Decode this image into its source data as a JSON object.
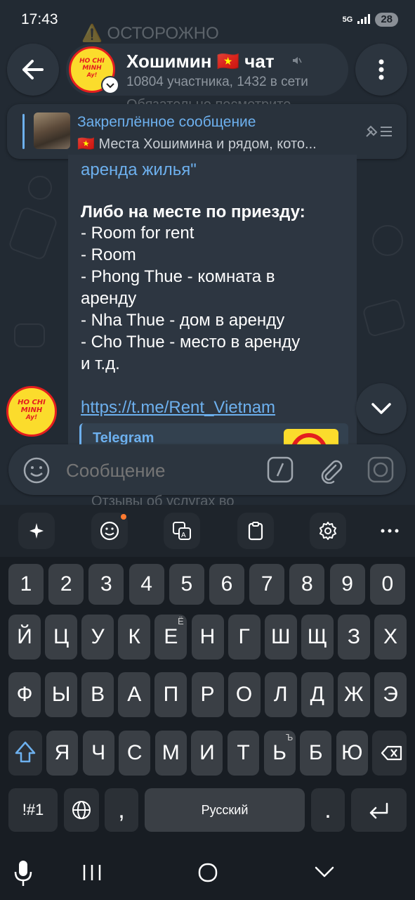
{
  "status_bar": {
    "time": "17:43",
    "network": "5G",
    "battery": "28"
  },
  "background_text": {
    "warning": "⚠️ ОСТОРОЖНО",
    "faded_line": "Обязательно посмотрите",
    "reviews": "Отзывы об услугах во"
  },
  "header": {
    "title": "Хошимин 🇻🇳 чат",
    "subtitle": "10804 участника, 1432 в сети",
    "logo_text": [
      "HO CHI",
      "MINH",
      "Ay!"
    ]
  },
  "pinned": {
    "label": "Закреплённое сообщение",
    "preview": "🇻🇳 Места Хошимина и рядом, кото..."
  },
  "message": {
    "lines": [
      "аренда жилья\"",
      "",
      "Либо на месте по приезду:",
      "- Room for rent",
      "- Room",
      "- Phong Thue - комната в",
      "аренду",
      "- Nha Thue - дом в аренду",
      "- Cho Thue - место в аренду",
      "и т.д.",
      "",
      "https://t.me/Rent_Vietnam"
    ],
    "preview_site": "Telegram"
  },
  "input": {
    "placeholder": "Сообщение"
  },
  "keyboard": {
    "numbers": [
      "1",
      "2",
      "3",
      "4",
      "5",
      "6",
      "7",
      "8",
      "9",
      "0"
    ],
    "row1": [
      "Й",
      "Ц",
      "У",
      "К",
      "Е",
      "Н",
      "Г",
      "Ш",
      "Щ",
      "З",
      "Х"
    ],
    "row1_hint": "Ё",
    "row2": [
      "Ф",
      "Ы",
      "В",
      "А",
      "П",
      "Р",
      "О",
      "Л",
      "Д",
      "Ж",
      "Э"
    ],
    "row3": [
      "Я",
      "Ч",
      "С",
      "М",
      "И",
      "Т",
      "Ь",
      "Б",
      "Ю"
    ],
    "row3_hint": "Ъ",
    "symbols": "!#1",
    "comma": ",",
    "space": "Русский",
    "period": "."
  },
  "colors": {
    "accent": "#6db0ee",
    "logo_yellow": "#fbdc2c",
    "logo_red": "#e41e1e"
  }
}
